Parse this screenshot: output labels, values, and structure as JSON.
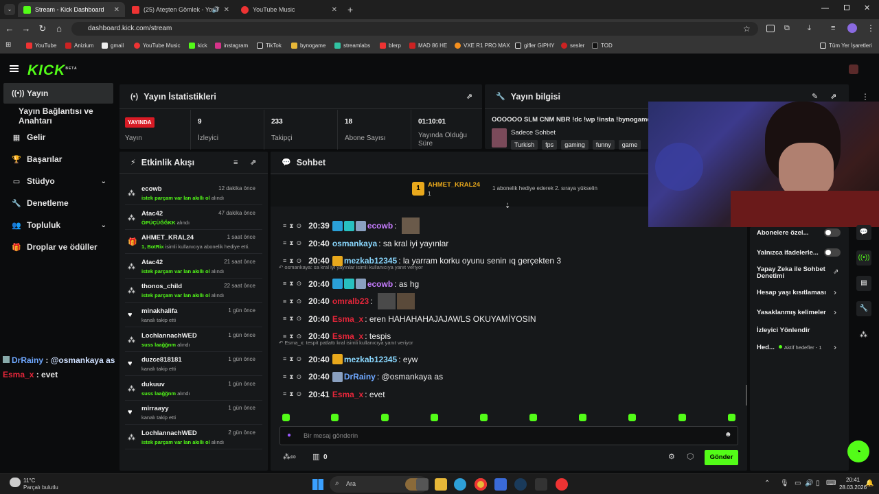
{
  "browser": {
    "tabs": [
      {
        "title": "Stream - Kick Dashboard"
      },
      {
        "title": "(25) Ateşten Gömlek - YouT"
      },
      {
        "title": "YouTube Music"
      }
    ],
    "url": "dashboard.kick.com/stream",
    "bookmarks": [
      "YouTube",
      "Anizium",
      "gmail",
      "YouTube Music",
      "kick",
      "instagram",
      "TikTok",
      "bynogame",
      "streamlabs",
      "blerp",
      "MAD 86 HE",
      "VXE R1 PRO MAX",
      "gifler GIPHY",
      "sesler",
      "TOD"
    ],
    "all_bookmarks": "Tüm Yer İşaretleri"
  },
  "kick": {
    "logo": "KICK",
    "logo_sup": "BETA",
    "nav": [
      {
        "label": "Yayın",
        "icon": "radio-icon"
      },
      {
        "label": "Yayın Bağlantısı ve Anahtarı",
        "icon": ""
      },
      {
        "label": "Gelir",
        "icon": "chart-icon"
      },
      {
        "label": "Başarılar",
        "icon": "trophy-icon"
      },
      {
        "label": "Stüdyo",
        "icon": "studio-icon"
      },
      {
        "label": "Denetleme",
        "icon": "wrench-icon"
      },
      {
        "label": "Topluluk",
        "icon": "community-icon"
      },
      {
        "label": "Droplar ve ödüller",
        "icon": "gift-icon"
      }
    ],
    "stats": {
      "title": "Yayın İstatistikleri",
      "live": "YAYINDA",
      "live_label": "Yayın",
      "items": [
        {
          "value": "9",
          "label": "İzleyici"
        },
        {
          "value": "233",
          "label": "Takipçi"
        },
        {
          "value": "18",
          "label": "Abone Sayısı"
        },
        {
          "value": "01:10:01",
          "label": "Yayında Olduğu Süre"
        }
      ]
    },
    "info": {
      "title": "Yayın bilgisi",
      "stream_title": "OOOOOO SLM CNM NBR !dc !wp !insta !bynogame",
      "category": "Sadece Sohbet",
      "tags": [
        "Turkish",
        "fps",
        "gaming",
        "funny",
        "game"
      ]
    },
    "activity": {
      "title": "Etkinlik Akışı",
      "items": [
        {
          "name": "ecowb",
          "time": "12 dakika önce",
          "desc_hl": "istek parçam var lan akıllı ol",
          "desc": " alındı",
          "icon": "drop-icon"
        },
        {
          "name": "Atac42",
          "time": "47 dakika önce",
          "desc_hl": "ÖPÜÇÜĞĞKK",
          "desc": " alındı",
          "icon": "drop-icon"
        },
        {
          "name": "AHMET_KRAL24",
          "time": "1 saat önce",
          "desc_hl": "1, BotRix",
          "desc": " isimli kullanıcıya abonelik hediye etti.",
          "icon": "gift-icon"
        },
        {
          "name": "Atac42",
          "time": "21 saat önce",
          "desc_hl": "istek parçam var lan akıllı ol",
          "desc": " alındı",
          "icon": "drop-icon"
        },
        {
          "name": "thonos_child",
          "time": "22 saat önce",
          "desc_hl": "istek parçam var lan akıllı ol",
          "desc": " alındı",
          "icon": "drop-icon"
        },
        {
          "name": "minakhalifa",
          "time": "1 gün önce",
          "desc_hl": "",
          "desc": "kanalı takip etti",
          "icon": "heart-icon"
        },
        {
          "name": "LochlannachWED",
          "time": "1 gün önce",
          "desc_hl": "suss laağğnm",
          "desc": " alındı",
          "icon": "drop-icon"
        },
        {
          "name": "duzce818181",
          "time": "1 gün önce",
          "desc_hl": "",
          "desc": "kanalı takip etti",
          "icon": "heart-icon"
        },
        {
          "name": "dukuuv",
          "time": "1 gün önce",
          "desc_hl": "suss laağğnm",
          "desc": " alındı",
          "icon": "drop-icon"
        },
        {
          "name": "mirraayy",
          "time": "1 gün önce",
          "desc_hl": "",
          "desc": "kanalı takip etti",
          "icon": "heart-icon"
        },
        {
          "name": "LochlannachWED",
          "time": "2 gün önce",
          "desc_hl": "istek parçam var lan akıllı ol",
          "desc": " alındı",
          "icon": "drop-icon"
        }
      ]
    },
    "chat": {
      "title": "Sohbet",
      "pinned": {
        "rank": "1",
        "user": "AHMET_KRAL24",
        "count": "1",
        "text": "1 abonelik hediye ederek 2. sıraya yükselin"
      },
      "messages": [
        {
          "time": "20:39",
          "user": "ecowb",
          "color": "#c67cff",
          "text": "",
          "reply": ""
        },
        {
          "time": "20:40",
          "user": "osmankaya",
          "color": "#8ad8ff",
          "text": "sa kral iyi yayınlar",
          "reply": ""
        },
        {
          "time": "20:40",
          "user": "mezkab12345",
          "color": "#8ad8ff",
          "text": "la yarram korku oyunu senin ıq gerçekten 3",
          "reply": ""
        },
        {
          "time": "20:40",
          "user": "ecowb",
          "color": "#c67cff",
          "text": "as hg",
          "reply": "osmankaya: sa kral iyi yayınlar isimli kullanıcıya yanıt veriyor"
        },
        {
          "time": "20:40",
          "user": "omralb23",
          "color": "#e5263a",
          "text": "",
          "reply": ""
        },
        {
          "time": "20:40",
          "user": "Esma_x",
          "color": "#e5263a",
          "text": "eren HAHAHAHAJAJAWLS OKUYAMİYOSIN",
          "reply": ""
        },
        {
          "time": "20:40",
          "user": "Esma_x",
          "color": "#e5263a",
          "text": "tespis",
          "reply": ""
        },
        {
          "time": "20:40",
          "user": "mezkab12345",
          "color": "#8ad8ff",
          "text": "eyw",
          "reply": "Esma_x: tespit patlattı kral isimli kullanıcıya yanıt veriyor"
        },
        {
          "time": "20:40",
          "user": "DrRainy",
          "color": "#6fa8ff",
          "text": "@osmankaya as",
          "reply": ""
        },
        {
          "time": "20:41",
          "user": "Esma_x",
          "color": "#e5263a",
          "text": "evet",
          "reply": ""
        }
      ],
      "placeholder": "Bir mesaj gönderin",
      "points": "0",
      "send": "Gönder"
    },
    "settings": [
      {
        "label": "Abonelere özel..."
      },
      {
        "label": "Yalnızca ifadelerle..."
      },
      {
        "label": "Yapay Zeka ile Sohbet Denetimi"
      },
      {
        "label": "Hesap yaşı kısıtlaması"
      },
      {
        "label": "Yasaklanmış kelimeler"
      },
      {
        "label": "İzleyici Yönlendir"
      },
      {
        "label": "Hed...",
        "sub": "Aktif hedefler - 1"
      }
    ]
  },
  "overlay": {
    "l1_user": "DrRainy",
    "l1_text": "@osmankaya as",
    "l2_user": "Esma_x",
    "l2_text": "evet"
  },
  "taskbar": {
    "temp": "11°C",
    "weather": "Parçalı bulutlu",
    "search": "Ara",
    "time": "20:41",
    "date": "28.03.2026"
  },
  "colors": {
    "accent": "#53fc18",
    "live": "#d81b25",
    "bg": "#0b0c0d",
    "panel": "#16181a"
  }
}
